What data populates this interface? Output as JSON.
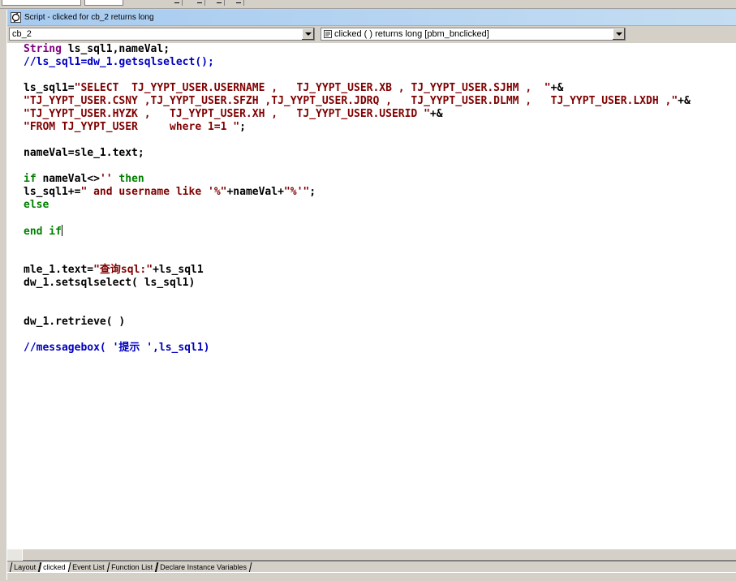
{
  "window": {
    "title": "Script - clicked for cb_2 returns long"
  },
  "selectors": {
    "object": "cb_2",
    "event": "clicked ( )  returns long [pbm_bnclicked]"
  },
  "code": [
    [
      {
        "t": "String",
        "c": "ty"
      },
      {
        "t": " ls_sql1,nameVal;"
      }
    ],
    [
      {
        "t": "//ls_sql1=dw_1.getsqlselect();",
        "c": "cm"
      }
    ],
    [],
    [
      {
        "t": "ls_sql1="
      },
      {
        "t": "\"SELECT  TJ_YYPT_USER.USERNAME ,   TJ_YYPT_USER.XB , TJ_YYPT_USER.SJHM ,  \"",
        "c": "str"
      },
      {
        "t": "+&"
      }
    ],
    [
      {
        "t": "\"TJ_YYPT_USER.CSNY ,TJ_YYPT_USER.SFZH ,TJ_YYPT_USER.JDRQ ,   TJ_YYPT_USER.DLMM ,   TJ_YYPT_USER.LXDH ,\"",
        "c": "str"
      },
      {
        "t": "+&"
      }
    ],
    [
      {
        "t": "\"TJ_YYPT_USER.HYZK ,   TJ_YYPT_USER.XH ,   TJ_YYPT_USER.USERID \"",
        "c": "str"
      },
      {
        "t": "+&"
      }
    ],
    [
      {
        "t": "\"FROM TJ_YYPT_USER     where 1=1 \"",
        "c": "str"
      },
      {
        "t": ";"
      }
    ],
    [],
    [
      {
        "t": "nameVal=sle_1.text;"
      }
    ],
    [],
    [
      {
        "t": "if",
        "c": "kw"
      },
      {
        "t": " nameVal<>"
      },
      {
        "t": "''",
        "c": "str"
      },
      {
        "t": " "
      },
      {
        "t": "then",
        "c": "kw"
      }
    ],
    [
      {
        "t": "ls_sql1+="
      },
      {
        "t": "\" and username like '%\"",
        "c": "str"
      },
      {
        "t": "+nameVal+"
      },
      {
        "t": "\"%'\"",
        "c": "str"
      },
      {
        "t": ";"
      }
    ],
    [
      {
        "t": "else",
        "c": "kw"
      }
    ],
    [],
    [
      {
        "t": "end if",
        "c": "kw"
      },
      {
        "t": "",
        "caret": true
      }
    ],
    [],
    [],
    [
      {
        "t": "mle_1.text="
      },
      {
        "t": "\"查询sql:\"",
        "c": "str"
      },
      {
        "t": "+ls_sql1"
      }
    ],
    [
      {
        "t": "dw_1.setsqlselect( ls_sql1)"
      }
    ],
    [],
    [],
    [
      {
        "t": "dw_1.retrieve( )"
      }
    ],
    [],
    [
      {
        "t": "//messagebox( '提示 ',ls_sql1)",
        "c": "cm"
      }
    ]
  ],
  "tabs": [
    {
      "label": "Layout",
      "active": false
    },
    {
      "label": "clicked",
      "active": true
    },
    {
      "label": "Event List",
      "active": false
    },
    {
      "label": "Function List",
      "active": false
    },
    {
      "label": "Declare Instance Variables",
      "active": false
    }
  ],
  "colors": {
    "keyword": "#008000",
    "type": "#800080",
    "string": "#800000",
    "comment": "#0000c0"
  }
}
